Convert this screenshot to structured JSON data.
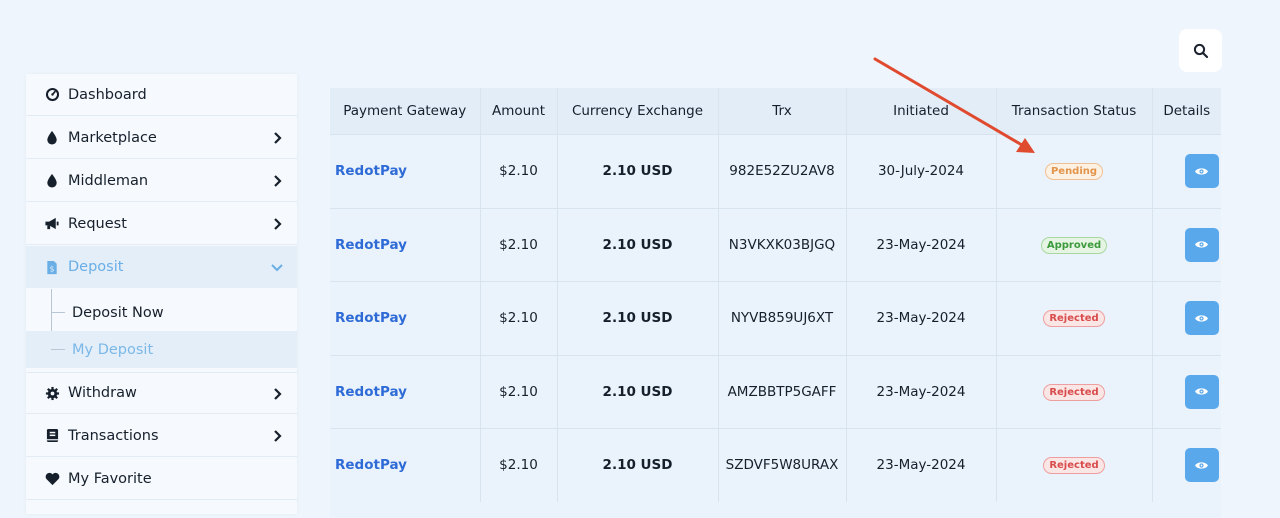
{
  "sidebar": {
    "items": [
      {
        "label": "Dashboard",
        "icon": "dashboard-icon",
        "chevron": false
      },
      {
        "label": "Marketplace",
        "icon": "drop-icon",
        "chevron": true
      },
      {
        "label": "Middleman",
        "icon": "drop-icon",
        "chevron": true
      },
      {
        "label": "Request",
        "icon": "megaphone-icon",
        "chevron": true
      },
      {
        "label": "Deposit",
        "icon": "deposit-icon",
        "chevron": true,
        "active": true
      },
      {
        "label": "Withdraw",
        "icon": "gear-icon",
        "chevron": true
      },
      {
        "label": "Transactions",
        "icon": "book-icon",
        "chevron": true
      },
      {
        "label": "My Favorite",
        "icon": "heart-icon",
        "chevron": false
      }
    ],
    "deposit_sub": [
      {
        "label": "Deposit Now",
        "active": false
      },
      {
        "label": "My Deposit",
        "active": true
      }
    ]
  },
  "table": {
    "headers": [
      "Payment Gateway",
      "Amount",
      "Currency Exchange",
      "Trx",
      "Initiated",
      "Transaction Status",
      "Details"
    ],
    "rows": [
      {
        "gateway": "RedotPay",
        "amount": "$2.10",
        "exchange": "2.10 USD",
        "trx": "982E52ZU2AV8",
        "initiated": "30-July-2024",
        "status": "Pending",
        "status_type": "pending"
      },
      {
        "gateway": "RedotPay",
        "amount": "$2.10",
        "exchange": "2.10 USD",
        "trx": "N3VKXK03BJGQ",
        "initiated": "23-May-2024",
        "status": "Approved",
        "status_type": "approved"
      },
      {
        "gateway": "RedotPay",
        "amount": "$2.10",
        "exchange": "2.10 USD",
        "trx": "NYVB859UJ6XT",
        "initiated": "23-May-2024",
        "status": "Rejected",
        "status_type": "rejected"
      },
      {
        "gateway": "RedotPay",
        "amount": "$2.10",
        "exchange": "2.10 USD",
        "trx": "AMZBBTP5GAFF",
        "initiated": "23-May-2024",
        "status": "Rejected",
        "status_type": "rejected"
      },
      {
        "gateway": "RedotPay",
        "amount": "$2.10",
        "exchange": "2.10 USD",
        "trx": "SZDVF5W8URAX",
        "initiated": "23-May-2024",
        "status": "Rejected",
        "status_type": "rejected"
      }
    ]
  },
  "colors": {
    "accent": "#5aa8ec",
    "gateway_link": "#2e6bd6",
    "annotation_arrow": "#e04a2f"
  }
}
